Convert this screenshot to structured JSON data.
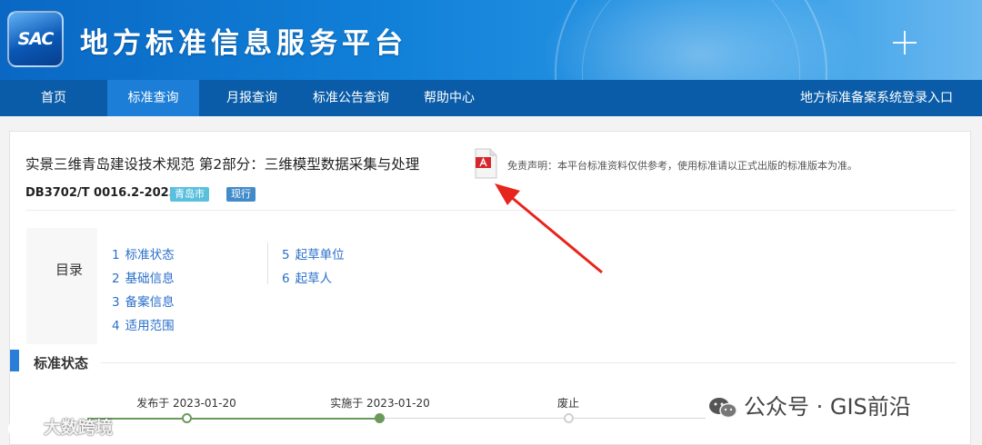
{
  "header": {
    "logo_text": "SAC",
    "site_title": "地方标准信息服务平台"
  },
  "nav": {
    "items": [
      {
        "label": "首页",
        "active": false
      },
      {
        "label": "标准查询",
        "active": true
      },
      {
        "label": "月报查询",
        "active": false
      },
      {
        "label": "标准公告查询",
        "active": false
      },
      {
        "label": "帮助中心",
        "active": false
      }
    ],
    "login_link": "地方标准备案系统登录入口"
  },
  "document": {
    "title": "实景三维青岛建设技术规范 第2部分：三维模型数据采集与处理",
    "disclaimer": "免责声明：本平台标准资料仅供参考，使用标准请以正式出版的标准版本为准。",
    "code": "DB3702/T 0016.2-2023",
    "region_badge": "青岛市",
    "status_badge": "现行"
  },
  "toc": {
    "title": "目录",
    "items": [
      {
        "num": "1",
        "label": "标准状态"
      },
      {
        "num": "2",
        "label": "基础信息"
      },
      {
        "num": "3",
        "label": "备案信息"
      },
      {
        "num": "4",
        "label": "适用范围"
      },
      {
        "num": "5",
        "label": "起草单位"
      },
      {
        "num": "6",
        "label": "起草人"
      }
    ]
  },
  "status_section": {
    "title": "标准状态",
    "timeline": [
      {
        "label": "发布于 2023-01-20",
        "state": "done"
      },
      {
        "label": "实施于 2023-01-20",
        "state": "current"
      },
      {
        "label": "废止",
        "state": "pending"
      }
    ]
  },
  "watermarks": {
    "left": "大数跨境",
    "right": "公众号 · GIS前沿"
  },
  "colors": {
    "nav_bg": "#0a5ca8",
    "nav_active": "#1c7ed6",
    "link": "#2a6fc9",
    "timeline": "#6a9a5a",
    "arrow": "#e8251d"
  }
}
